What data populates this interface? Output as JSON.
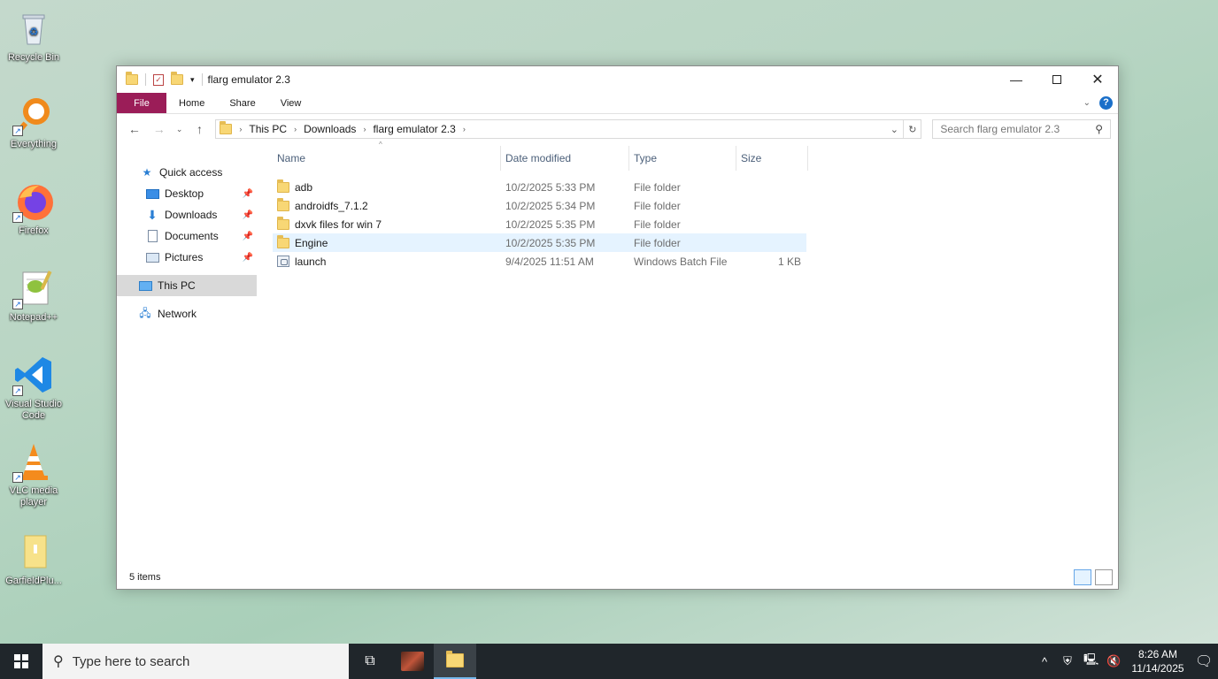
{
  "desktop": {
    "icons": [
      {
        "label": "Recycle Bin"
      },
      {
        "label": "Everything"
      },
      {
        "label": "Firefox"
      },
      {
        "label": "Notepad++"
      },
      {
        "label": "Visual Studio Code"
      },
      {
        "label": "VLC media player"
      },
      {
        "label": "GarfieldPlu..."
      }
    ]
  },
  "window": {
    "title": "flarg emulator 2.3",
    "ribbon_tabs": [
      "File",
      "Home",
      "Share",
      "View"
    ],
    "breadcrumb": [
      "This PC",
      "Downloads",
      "flarg emulator 2.3"
    ],
    "search_placeholder": "Search flarg emulator 2.3",
    "nav_pane": {
      "quick_access": "Quick access",
      "items": [
        "Desktop",
        "Downloads",
        "Documents",
        "Pictures"
      ],
      "this_pc": "This PC",
      "network": "Network"
    },
    "columns": [
      "Name",
      "Date modified",
      "Type",
      "Size"
    ],
    "files": [
      {
        "name": "adb",
        "date": "10/2/2025 5:33 PM",
        "type": "File folder",
        "size": ""
      },
      {
        "name": "androidfs_7.1.2",
        "date": "10/2/2025 5:34 PM",
        "type": "File folder",
        "size": ""
      },
      {
        "name": "dxvk files for win 7",
        "date": "10/2/2025 5:35 PM",
        "type": "File folder",
        "size": ""
      },
      {
        "name": "Engine",
        "date": "10/2/2025 5:35 PM",
        "type": "File folder",
        "size": ""
      },
      {
        "name": "launch",
        "date": "9/4/2025 11:51 AM",
        "type": "Windows Batch File",
        "size": "1 KB"
      }
    ],
    "status": "5 items"
  },
  "taskbar": {
    "search_placeholder": "Type here to search",
    "time": "8:26 AM",
    "date": "11/14/2025"
  },
  "colors": {
    "file_tab": "#9b1d58",
    "folder": "#f8d775",
    "hover_row": "#e5f3ff",
    "taskbar": "#20262b"
  }
}
